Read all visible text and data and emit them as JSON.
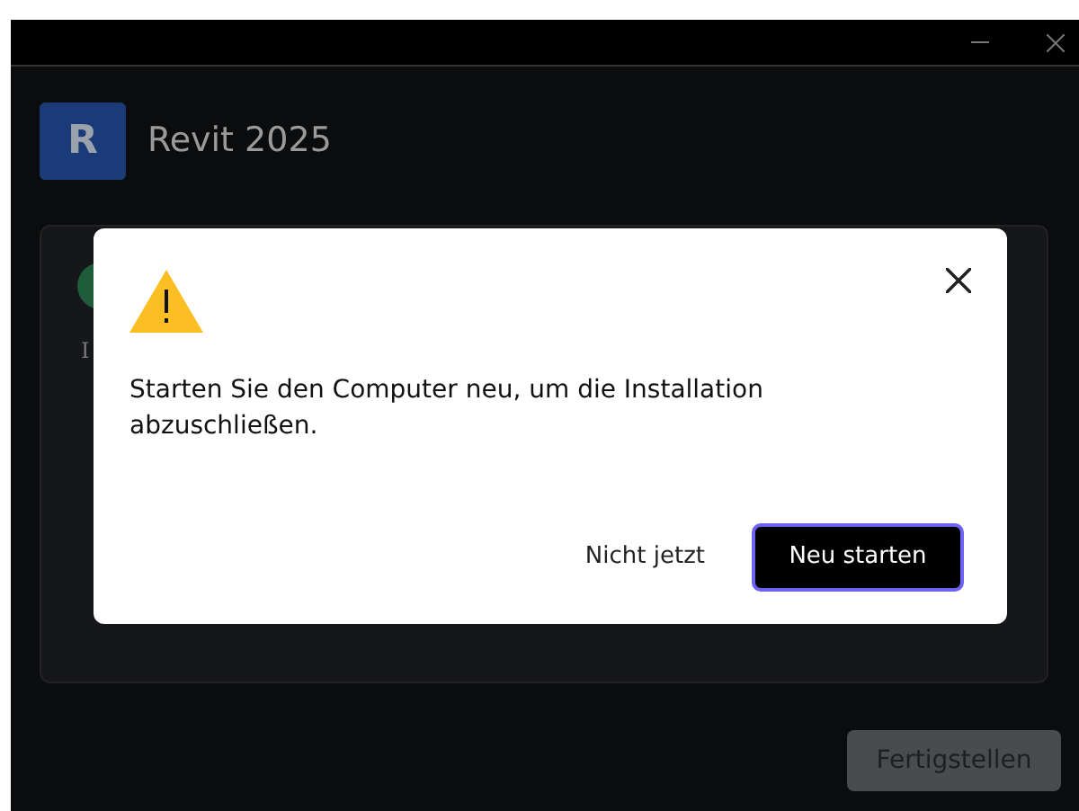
{
  "window": {
    "title": "Revit 2025",
    "logo_letter": "R"
  },
  "background_text": "I",
  "dialog": {
    "message": "Starten Sie den Computer neu, um die Installation abzuschließen.",
    "buttons": [
      {
        "label": "Nicht jetzt",
        "kind": "secondary",
        "focused": false
      },
      {
        "label": "Neu starten",
        "kind": "primary",
        "focused": true
      }
    ]
  },
  "footer_button": {
    "label": "Fertigstellen",
    "disabled": true
  }
}
